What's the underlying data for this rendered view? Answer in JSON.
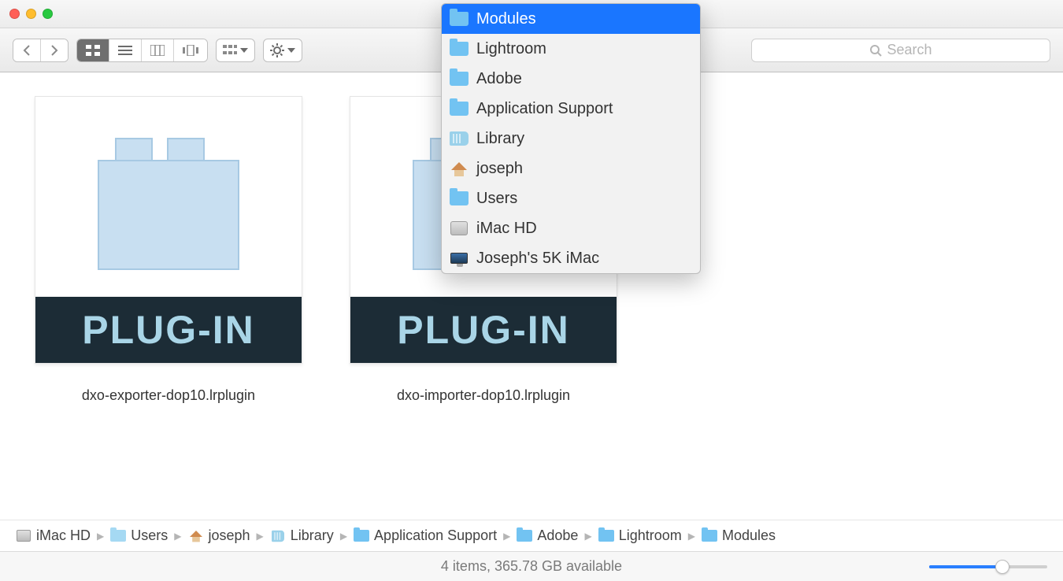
{
  "search": {
    "placeholder": "Search"
  },
  "path_popup": {
    "items": [
      {
        "label": "Modules",
        "icon": "folder",
        "selected": true
      },
      {
        "label": "Lightroom",
        "icon": "folder"
      },
      {
        "label": "Adobe",
        "icon": "folder"
      },
      {
        "label": "Application Support",
        "icon": "folder"
      },
      {
        "label": "Library",
        "icon": "library"
      },
      {
        "label": "joseph",
        "icon": "home"
      },
      {
        "label": "Users",
        "icon": "folder"
      },
      {
        "label": "iMac HD",
        "icon": "hdd"
      },
      {
        "label": "Joseph's 5K iMac",
        "icon": "imac"
      }
    ]
  },
  "files": [
    {
      "name": "dxo-exporter-dop10.lrplugin",
      "band": "PLUG-IN"
    },
    {
      "name": "dxo-importer-dop10.lrplugin",
      "band": "PLUG-IN"
    }
  ],
  "path_bar": [
    {
      "label": "iMac HD",
      "icon": "hdd"
    },
    {
      "label": "Users",
      "icon": "users-folder"
    },
    {
      "label": "joseph",
      "icon": "home"
    },
    {
      "label": "Library",
      "icon": "library"
    },
    {
      "label": "Application Support",
      "icon": "folder"
    },
    {
      "label": "Adobe",
      "icon": "folder"
    },
    {
      "label": "Lightroom",
      "icon": "folder"
    },
    {
      "label": "Modules",
      "icon": "folder"
    }
  ],
  "status": {
    "text": "4 items, 365.78 GB available"
  }
}
